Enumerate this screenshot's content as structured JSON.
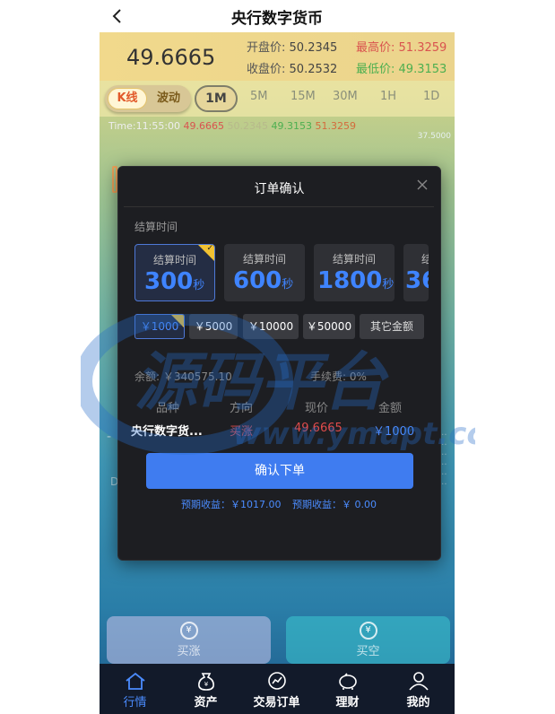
{
  "header": {
    "title": "央行数字货币"
  },
  "price": {
    "current": "49.6665",
    "open_label": "开盘价:",
    "open": "50.2345",
    "high_label": "最高价:",
    "high": "51.3259",
    "close_label": "收盘价:",
    "close": "50.2532",
    "low_label": "最低价:",
    "low": "49.3153"
  },
  "tabs": {
    "kline": "K线",
    "wave": "波动",
    "intervals": [
      "1M",
      "5M",
      "15M",
      "30M",
      "1H",
      "1D"
    ]
  },
  "chart_info": {
    "time": "Time:11:55:00",
    "v1": "49.6665",
    "v2": "50.2345",
    "v3": "49.3153",
    "v4": "51.3259",
    "axis_top": "37.5000"
  },
  "modal": {
    "title": "订单确认",
    "settle_label": "结算时间",
    "cards": [
      {
        "label": "结算时间",
        "value": "300",
        "unit": "秒"
      },
      {
        "label": "结算时间",
        "value": "600",
        "unit": "秒"
      },
      {
        "label": "结算时间",
        "value": "1800",
        "unit": "秒"
      },
      {
        "label": "结",
        "value": "36",
        "unit": ""
      }
    ],
    "amounts": [
      "￥1000",
      "￥5000",
      "￥10000",
      "￥50000",
      "其它金额"
    ],
    "balance": "余额: ￥340575.10",
    "fee": "手续费: 0%",
    "table_headers": [
      "品种",
      "方向",
      "现价",
      "金额"
    ],
    "row": {
      "name": "央行数字货...",
      "direction": "买涨",
      "price": "49.6665",
      "amount": "￥1000"
    },
    "confirm": "确认下单",
    "expect_income": "预期收益：￥1017.00",
    "expect_loss": "预期收益：￥ 0.00"
  },
  "trade": {
    "buy_up": "买涨",
    "buy_down": "买空"
  },
  "nav": [
    {
      "label": "行情",
      "icon": "home-icon"
    },
    {
      "label": "资产",
      "icon": "money-bag-icon"
    },
    {
      "label": "交易订单",
      "icon": "chart-circle-icon"
    },
    {
      "label": "理财",
      "icon": "piggy-bank-icon"
    },
    {
      "label": "我的",
      "icon": "user-icon"
    }
  ],
  "watermark": {
    "cn": "源码平台",
    "url": "www.ymupt.cc"
  },
  "colors": {
    "accent": "#3f7cf0",
    "red": "#d9534f",
    "green": "#4caf50",
    "modal_bg": "#1d1e22"
  }
}
